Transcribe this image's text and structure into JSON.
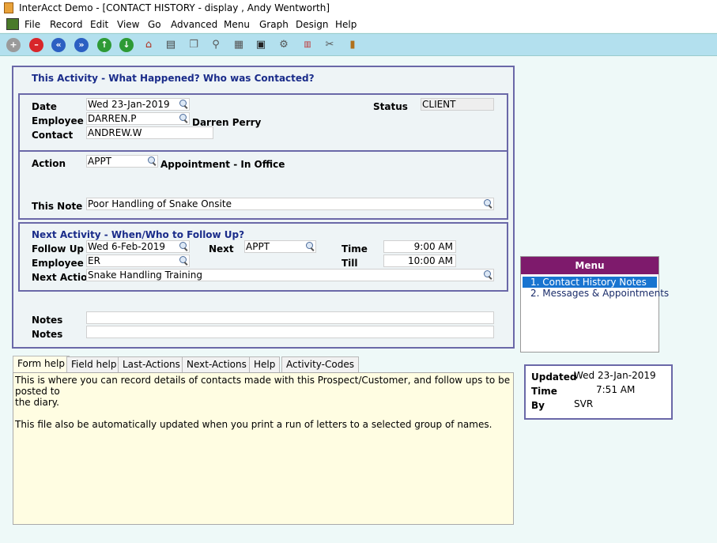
{
  "window": {
    "title": "InterAcct Demo - [CONTACT HISTORY - display , Andy Wentworth]"
  },
  "menubar": [
    "File",
    "Record",
    "Edit",
    "View",
    "Go",
    "Advanced",
    "Menu",
    "Graph",
    "Design",
    "Help"
  ],
  "toolbar": {
    "buttons": [
      "add",
      "delete",
      "first",
      "last",
      "next",
      "previous",
      "home",
      "print",
      "copy",
      "search",
      "calculator",
      "monitor",
      "settings",
      "calendar",
      "cut",
      "exit"
    ]
  },
  "activity": {
    "heading": "This Activity - What Happened? Who was Contacted?",
    "date_label": "Date",
    "date_value": "Wed 23-Jan-2019",
    "employee_label": "Employee",
    "employee_value": "DARREN.P",
    "employee_name": "Darren Perry",
    "contact_label": "Contact",
    "contact_value": "ANDREW.W",
    "status_label": "Status",
    "status_value": "CLIENT",
    "action_label": "Action",
    "action_value": "APPT",
    "action_desc": "Appointment - In Office",
    "note_label": "This Note",
    "note_value": "Poor Handling of Snake Onsite"
  },
  "next": {
    "heading": "Next Activity - When/Who to Follow Up?",
    "followup_label": "Follow Up",
    "followup_value": "Wed 6-Feb-2019",
    "next_label": "Next",
    "next_value": "APPT",
    "time_label": "Time",
    "time_value": "9:00 AM",
    "employee_label": "Employee",
    "employee_value": "ER",
    "till_label": "Till",
    "till_value": "10:00 AM",
    "action_label": "Next Action",
    "action_value": "Snake Handling Training"
  },
  "notes": {
    "label1": "Notes",
    "label2": "Notes",
    "value1": "",
    "value2": ""
  },
  "menu": {
    "title": "Menu",
    "items": [
      "1. Contact History Notes",
      "2. Messages & Appointments"
    ],
    "selected": 0
  },
  "tabs": [
    "Form help",
    "Field help",
    "Last-Actions",
    "Next-Actions",
    "Help",
    "Activity-Codes"
  ],
  "help": {
    "text": "This is where you can record details of contacts made with this Prospect/Customer, and follow ups to be posted to\nthe diary.\n\nThis file also be automatically updated when you print a run of letters to a selected group of names."
  },
  "updated": {
    "updated_label": "Updated",
    "updated_value": "Wed 23-Jan-2019",
    "time_label": "Time",
    "time_value": "7:51 AM",
    "by_label": "By",
    "by_value": "SVR"
  },
  "colors": {
    "panel_border": "#6a68a8",
    "section_title": "#1a2c8a",
    "menu_header": "#7e1a6c",
    "menu_selected": "#1874d0",
    "toolbar_bg": "#b3e0ee",
    "help_bg": "#fffde2"
  }
}
